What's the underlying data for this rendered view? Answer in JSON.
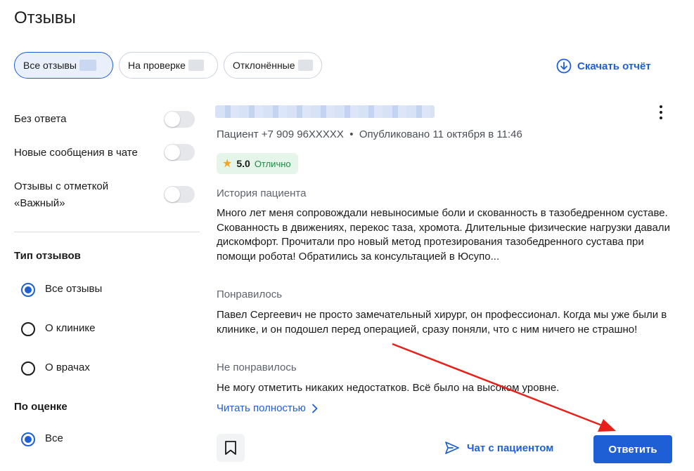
{
  "page": {
    "title": "Отзывы"
  },
  "tabs": [
    {
      "label": "Все отзывы",
      "active": true
    },
    {
      "label": "На проверке",
      "active": false
    },
    {
      "label": "Отклонённые",
      "active": false
    }
  ],
  "download": {
    "label": "Скачать отчёт",
    "icon": "download-circle-icon"
  },
  "filters": {
    "toggles": [
      {
        "label": "Без ответа",
        "on": false
      },
      {
        "label": "Новые сообщения в чате",
        "on": false
      },
      {
        "label": "Отзывы с отметкой\n«Важный»",
        "on": false
      }
    ],
    "review_type": {
      "heading": "Тип отзывов",
      "options": [
        {
          "label": "Все отзывы",
          "checked": true
        },
        {
          "label": "О клинике",
          "checked": false
        },
        {
          "label": "О врачах",
          "checked": false
        }
      ]
    },
    "by_rating": {
      "heading": "По оценке",
      "options": [
        {
          "label": "Все",
          "checked": true
        }
      ]
    }
  },
  "review": {
    "meta": "Пациент +7 909 96XXXXX  •  Опубликовано 11 октября в 11:46",
    "rating": {
      "value": "5.0",
      "text": "Отлично",
      "icon": "star-icon"
    },
    "history": {
      "label": "История пациента",
      "text": "Много лет меня сопровождали невыносимые боли и скованность в тазобедренном суставе. Скованность в движениях, перекос таза, хромота. Длительные физические нагрузки давали дискомфорт. Прочитали про новый метод протезирования тазобедренного сустава при помощи робота! Обратились за консультацией в Юсупо..."
    },
    "liked": {
      "label": "Понравилось",
      "text": "Павел Сергеевич не просто замечательный хирург, он профессионал. Когда мы уже были в клинике, и он подошел перед операцией, сразу поняли, что с ним ничего не страшно!"
    },
    "disliked": {
      "label": "Не понравилось",
      "text": "Не могу отметить никаких недостатков. Всё было на высоком уровне."
    },
    "read_more": "Читать полностью",
    "actions": {
      "chat": "Чат с пациентом",
      "reply": "Ответить"
    }
  },
  "colors": {
    "accent": "#1f5fd6",
    "annotation_arrow": "#e8201a",
    "rating_bg": "#e5f5ea",
    "rating_text": "#1c8a45"
  }
}
